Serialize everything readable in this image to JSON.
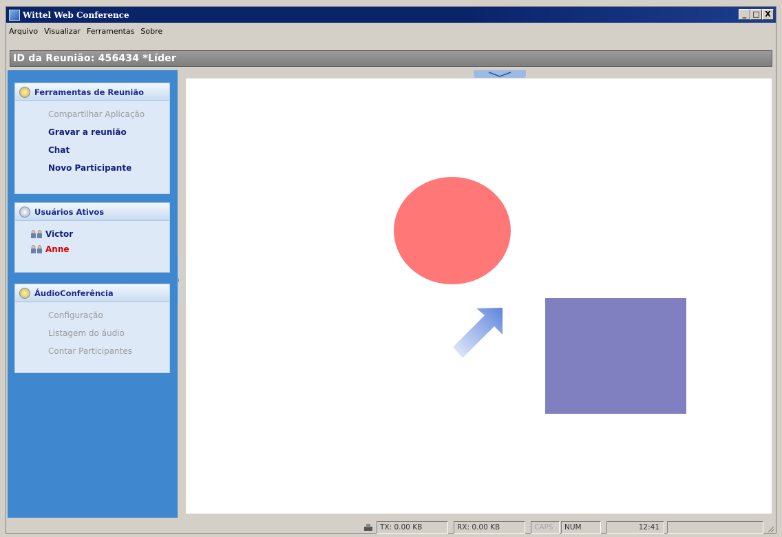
{
  "window": {
    "title": "Wittel Web Conference"
  },
  "window_buttons": [
    "_",
    "□",
    "X"
  ],
  "menu": [
    "Arquivo",
    "Visualizar",
    "Ferramentas",
    "Sobre"
  ],
  "meeting_bar": {
    "text": "ID da Reunião: 456434 *Líder"
  },
  "panels": {
    "tools": {
      "title": "Ferramentas de Reunião",
      "icon": "meeting-tools-icon",
      "items": [
        {
          "label": "Compartilhar Aplicação",
          "enabled": false
        },
        {
          "label": "Gravar a reunião",
          "enabled": true
        },
        {
          "label": "Chat",
          "enabled": true
        },
        {
          "label": "Novo Participante",
          "enabled": true
        }
      ]
    },
    "users": {
      "title": "Usuários Ativos",
      "icon": "users-icon",
      "items": [
        {
          "name": "Victor",
          "color": "#12207a"
        },
        {
          "name": "Anne",
          "color": "#e00000"
        }
      ]
    },
    "audio": {
      "title": "ÁudioConferência",
      "icon": "audio-icon",
      "items": [
        {
          "label": "Configuração",
          "enabled": false
        },
        {
          "label": "Listagem do áudio",
          "enabled": false
        },
        {
          "label": "Contar Participantes",
          "enabled": false
        }
      ]
    }
  },
  "whiteboard": {
    "shapes": [
      {
        "type": "ellipse",
        "color": "#ff7777"
      },
      {
        "type": "arrow",
        "color": "#6a8fe0"
      },
      {
        "type": "rectangle",
        "color": "#8080c0"
      }
    ]
  },
  "statusbar": {
    "tx": "TX: 0.00 KB",
    "rx": "RX: 0.00 KB",
    "caps": "CAPS",
    "num": "NUM",
    "time": "12:41"
  },
  "colors": {
    "titlebar": "#0a246a",
    "sidebar": "#3f87cf",
    "panel_bg": "#dde9f7",
    "active_item": "#12207a"
  }
}
